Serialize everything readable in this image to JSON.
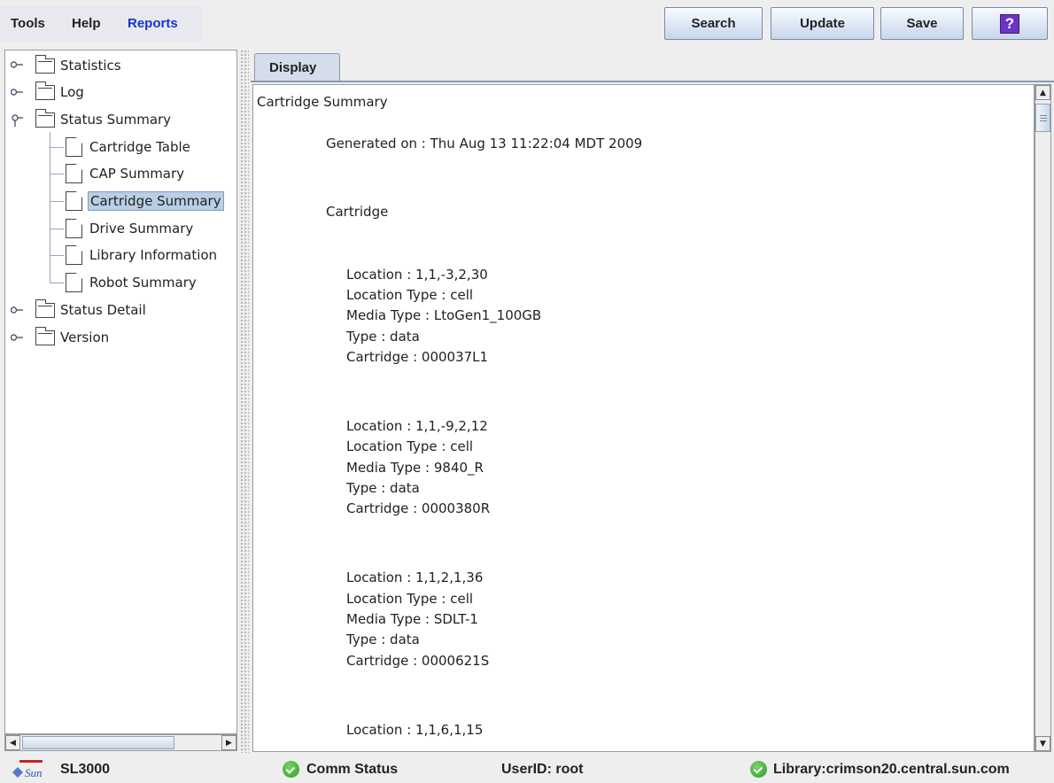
{
  "menu": {
    "items": [
      {
        "label": "Tools"
      },
      {
        "label": "Help"
      },
      {
        "label": "Reports"
      }
    ]
  },
  "toolbar": {
    "search_label": "Search",
    "update_label": "Update",
    "save_label": "Save",
    "help_label": "?"
  },
  "tree": {
    "nodes": [
      {
        "label": "Statistics",
        "kind": "folder"
      },
      {
        "label": "Log",
        "kind": "folder"
      },
      {
        "label": "Status Summary",
        "kind": "folder"
      },
      {
        "label": "Cartridge Table",
        "kind": "document"
      },
      {
        "label": "CAP Summary",
        "kind": "document"
      },
      {
        "label": "Cartridge Summary",
        "kind": "document",
        "selected": true
      },
      {
        "label": "Drive Summary",
        "kind": "document"
      },
      {
        "label": "Library Information",
        "kind": "document"
      },
      {
        "label": "Robot Summary",
        "kind": "document"
      },
      {
        "label": "Status Detail",
        "kind": "folder"
      },
      {
        "label": "Version",
        "kind": "folder"
      }
    ]
  },
  "display": {
    "tab_label": "Display",
    "report_title": "Cartridge Summary",
    "generated_on": "Generated on : Thu Aug 13 11:22:04 MDT 2009",
    "section_heading": "Cartridge",
    "entries": [
      {
        "location": "Location : 1,1,-3,2,30",
        "location_type": "Location Type : cell",
        "media_type": "Media Type : LtoGen1_100GB",
        "type": "Type : data",
        "cartridge": "Cartridge : 000037L1"
      },
      {
        "location": "Location : 1,1,-9,2,12",
        "location_type": "Location Type : cell",
        "media_type": "Media Type : 9840_R",
        "type": "Type : data",
        "cartridge": "Cartridge : 0000380R"
      },
      {
        "location": "Location : 1,1,2,1,36",
        "location_type": "Location Type : cell",
        "media_type": "Media Type : SDLT-1",
        "type": "Type : data",
        "cartridge": "Cartridge : 0000621S"
      },
      {
        "location": "Location : 1,1,6,1,15"
      }
    ]
  },
  "statusbar": {
    "product": "SL3000",
    "logo_text": "Sun",
    "comm_status": "Comm Status",
    "user": "UserID: root",
    "library": "Library:crimson20.central.sun.com"
  },
  "colors": {
    "accent_menu": "#1a33cc",
    "selection": "#b8cfe5",
    "ok_green": "#2e9a24",
    "help_purple": "#6b35c4"
  }
}
